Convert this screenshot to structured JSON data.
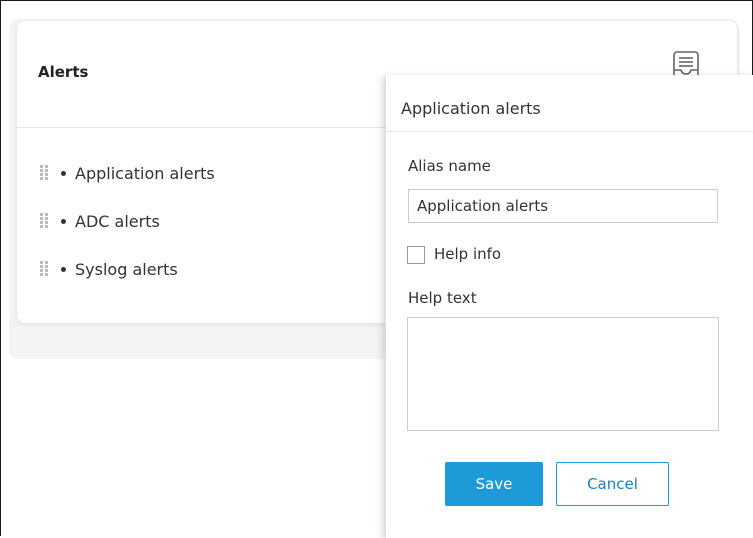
{
  "alerts_card": {
    "title": "Alerts",
    "header_icon": "archive-tray-icon",
    "items": [
      {
        "label": "Application alerts",
        "icon": "drag-handle-icon"
      },
      {
        "label": "ADC alerts",
        "icon": "drag-handle-icon"
      },
      {
        "label": "Syslog alerts",
        "icon": "drag-handle-icon"
      }
    ]
  },
  "edit_panel": {
    "title": "Application alerts",
    "alias_label": "Alias name",
    "alias_value": "Application alerts",
    "help_info_label": "Help info",
    "help_info_checked": false,
    "help_text_label": "Help text",
    "help_text_value": "",
    "save_label": "Save",
    "cancel_label": "Cancel"
  },
  "colors": {
    "accent": "#1d9ad8",
    "cancel_text": "#1d7fc0",
    "text": "#333333"
  }
}
